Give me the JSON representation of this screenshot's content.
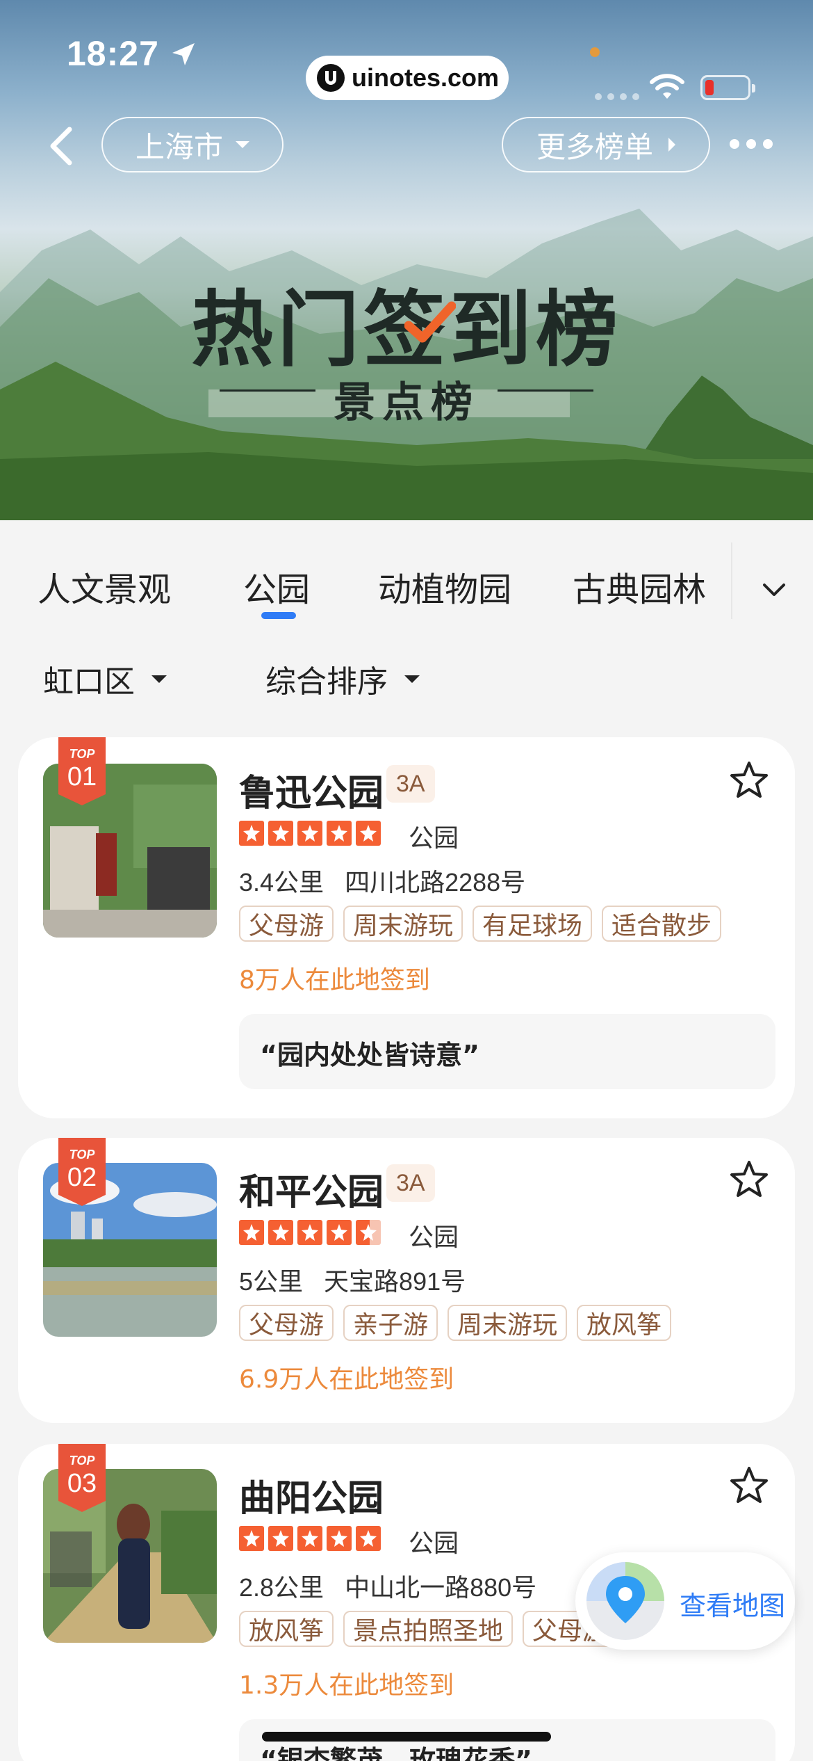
{
  "status_bar": {
    "time": "18:27",
    "url": "uinotes.com"
  },
  "header": {
    "city": "上海市",
    "more": "更多榜单"
  },
  "hero": {
    "title": "热门签到榜",
    "subtitle": "景点榜"
  },
  "tabs": [
    {
      "label": "人文景观",
      "active": false
    },
    {
      "label": "公园",
      "active": true
    },
    {
      "label": "动植物园",
      "active": false
    },
    {
      "label": "古典园林",
      "active": false
    }
  ],
  "filters": {
    "district": "虹口区",
    "sort": "综合排序"
  },
  "top_label": "TOP",
  "colors": {
    "accent": "#2f7cf6",
    "rank_tag": "#e8543a",
    "star": "#f56032",
    "checkin": "#ec8a3c",
    "tag_text": "#8a5a3b"
  },
  "items": [
    {
      "rank": "01",
      "name": "鲁迅公园",
      "level": "3A",
      "rating": 5,
      "category": "公园",
      "distance": "3.4公里",
      "address": "四川北路2288号",
      "tags": [
        "父母游",
        "周末游玩",
        "有足球场",
        "适合散步"
      ],
      "checkins": "8万人在此地签到",
      "quote": "“园内处处皆诗意”"
    },
    {
      "rank": "02",
      "name": "和平公园",
      "level": "3A",
      "rating": 4.5,
      "category": "公园",
      "distance": "5公里",
      "address": "天宝路891号",
      "tags": [
        "父母游",
        "亲子游",
        "周末游玩",
        "放风筝"
      ],
      "checkins": "6.9万人在此地签到"
    },
    {
      "rank": "03",
      "name": "曲阳公园",
      "rating": 5,
      "category": "公园",
      "distance": "2.8公里",
      "address": "中山北一路880号",
      "tags": [
        "放风筝",
        "景点拍照圣地",
        "父母游"
      ],
      "checkins": "1.3万人在此地签到",
      "quote": "“银杏繁茂，玫瑰花香”"
    }
  ],
  "map_button": {
    "label": "查看地图"
  },
  "icons": [
    "location-arrow-icon",
    "wifi-icon",
    "battery-icon",
    "back-chevron-icon",
    "more-dots-icon",
    "chevron-down-icon",
    "star-outline-icon",
    "map-pin-icon"
  ]
}
